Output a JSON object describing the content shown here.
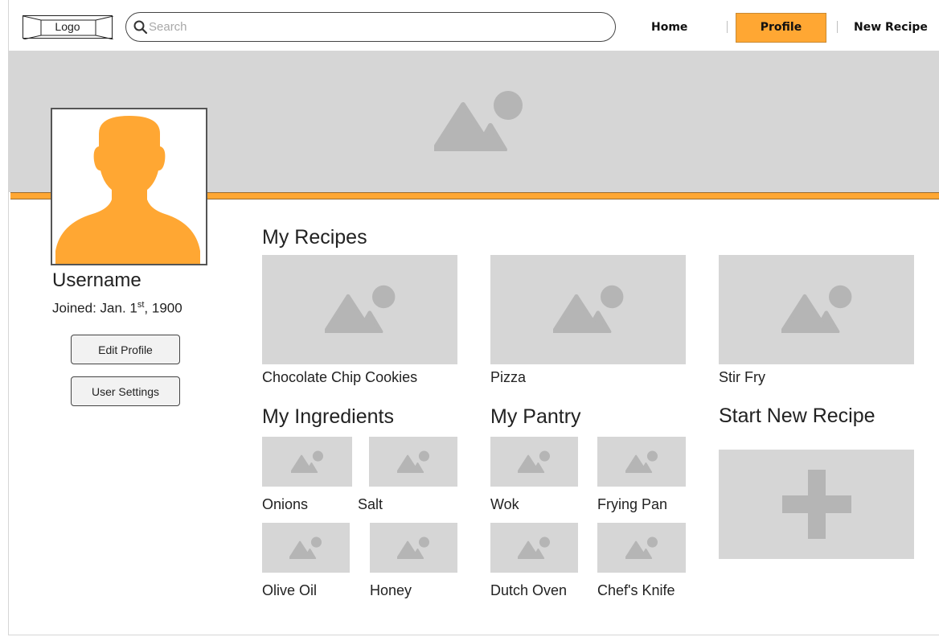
{
  "header": {
    "logo_label": "Logo",
    "search_placeholder": "Search",
    "nav": {
      "home": "Home",
      "profile": "Profile",
      "new_recipe": "New Recipe"
    },
    "active_nav": "Profile"
  },
  "profile": {
    "username": "Username",
    "joined_prefix": "Joined: Jan. 1",
    "joined_suffix": "st",
    "joined_year": ", 1900",
    "edit_button": "Edit Profile",
    "settings_button": "User Settings"
  },
  "recipes": {
    "title": "My Recipes",
    "items": [
      "Chocolate Chip Cookies",
      "Pizza",
      "Stir Fry"
    ]
  },
  "ingredients": {
    "title": "My Ingredients",
    "items": [
      "Onions",
      "Salt",
      "Olive Oil",
      "Honey"
    ]
  },
  "pantry": {
    "title": "My Pantry",
    "items": [
      "Wok",
      "Frying Pan",
      "Dutch Oven",
      "Chef's Knife"
    ]
  },
  "new_recipe": {
    "title": "Start New Recipe"
  },
  "colors": {
    "accent": "#ffa733",
    "placeholder_bg": "#d6d6d6",
    "placeholder_icon": "#b5b5b5"
  },
  "icons": {
    "search": "search-icon",
    "image_placeholder": "image-icon",
    "avatar": "user-silhouette-icon",
    "add": "plus-icon"
  }
}
